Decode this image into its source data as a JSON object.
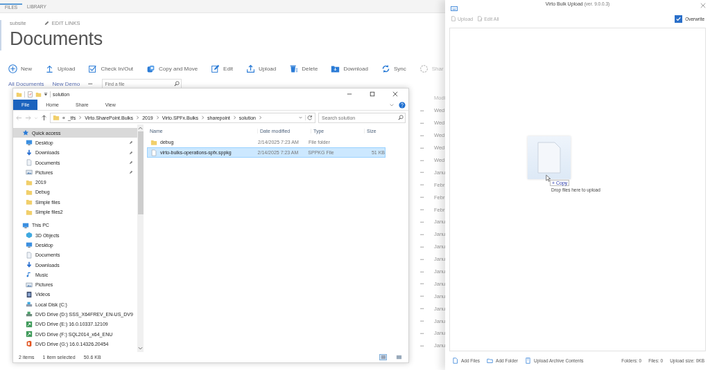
{
  "sharepoint": {
    "ribbon_tabs": [
      "FILES",
      "LIBRARY"
    ],
    "subsite": "subsite",
    "edit_links": "EDIT LINKS",
    "title": "Documents",
    "toolbar": [
      "New",
      "Upload",
      "Check In/Out",
      "Copy and Move",
      "Edit",
      "Upload",
      "Delete",
      "Download",
      "Sync",
      "Shar"
    ],
    "views": [
      "All Documents",
      "New Demo"
    ],
    "views_more": "•••",
    "search": {
      "placeholder": "Find a file"
    },
    "list_header": "Modi",
    "rows": [
      {
        "menu": "•••",
        "modified": "Wed"
      },
      {
        "menu": "•••",
        "modified": "Wed"
      },
      {
        "menu": "•••",
        "modified": "Wed"
      },
      {
        "menu": "•••",
        "modified": "Wed"
      },
      {
        "menu": "•••",
        "modified": "Wed"
      },
      {
        "menu": "•••",
        "modified": "Janu"
      },
      {
        "menu": "•••",
        "modified": "Febr"
      },
      {
        "menu": "•••",
        "modified": "Febr"
      },
      {
        "menu": "•••",
        "modified": "Febr"
      },
      {
        "menu": "•••",
        "modified": "Janu"
      },
      {
        "menu": "•••",
        "modified": "Janu"
      },
      {
        "menu": "•••",
        "modified": "Janu"
      },
      {
        "menu": "•••",
        "modified": "Janu"
      },
      {
        "menu": "•••",
        "modified": "Janu"
      },
      {
        "menu": "•••",
        "modified": "Janu"
      },
      {
        "menu": "•••",
        "modified": "Janu"
      },
      {
        "menu": "•••",
        "modified": "Janu"
      },
      {
        "menu": "•••",
        "modified": "Janu"
      },
      {
        "menu": "•••",
        "modified": "Janu"
      },
      {
        "menu": "•••",
        "modified": "Janu"
      }
    ]
  },
  "explorer": {
    "title": "solution",
    "ribbon_tabs": [
      {
        "label": "File",
        "selected": true
      },
      {
        "label": "Home",
        "selected": false
      },
      {
        "label": "Share",
        "selected": false
      },
      {
        "label": "View",
        "selected": false
      }
    ],
    "path_prefix": "«",
    "path": [
      "_tfs",
      "Virto.SharePoint.Bulks",
      "2019",
      "Virto.SPFx.Bulks",
      "sharepoint",
      "solution"
    ],
    "search": {
      "placeholder": "Search solution"
    },
    "nav": [
      {
        "label": "Quick access",
        "kind": "star",
        "selected": true,
        "children": [
          {
            "label": "Desktop",
            "kind": "desktop",
            "pinned": true
          },
          {
            "label": "Downloads",
            "kind": "download",
            "pinned": true
          },
          {
            "label": "Documents",
            "kind": "documents",
            "pinned": true
          },
          {
            "label": "Pictures",
            "kind": "pictures",
            "pinned": true
          },
          {
            "label": "2019",
            "kind": "folder",
            "pinned": false
          },
          {
            "label": "Debug",
            "kind": "folder",
            "pinned": false
          },
          {
            "label": "Simple files",
            "kind": "folder",
            "pinned": false
          },
          {
            "label": "Simple files2",
            "kind": "folder",
            "pinned": false
          }
        ]
      },
      {
        "label": "This PC",
        "kind": "pc",
        "selected": false,
        "children": [
          {
            "label": "3D Objects",
            "kind": "objects"
          },
          {
            "label": "Desktop",
            "kind": "desktop"
          },
          {
            "label": "Documents",
            "kind": "documents"
          },
          {
            "label": "Downloads",
            "kind": "download"
          },
          {
            "label": "Music",
            "kind": "music"
          },
          {
            "label": "Pictures",
            "kind": "pictures"
          },
          {
            "label": "Videos",
            "kind": "videos"
          },
          {
            "label": "Local Disk (C:)",
            "kind": "disk"
          },
          {
            "label": "DVD Drive (D:) SSS_X64FREV_EN-US_DV9",
            "kind": "dvd"
          },
          {
            "label": "DVD Drive (E:) 16.0.10337.12109",
            "kind": "setup"
          },
          {
            "label": "DVD Drive (F:) SQL2014_x64_ENU",
            "kind": "setup"
          },
          {
            "label": "DVD Drive (G:) 16.0.14326.20454",
            "kind": "office"
          }
        ]
      }
    ],
    "columns": [
      "Name",
      "Date modified",
      "Type",
      "Size"
    ],
    "files": [
      {
        "name": "debug",
        "kind": "folder",
        "date": "2/14/2025 7:23 AM",
        "type": "File folder",
        "selected": false
      },
      {
        "name": "virto-bulks-operations-spfx.sppkg",
        "kind": "file",
        "date": "2/14/2025 7:23 AM",
        "type": "SPPKG File",
        "size": "51 KB",
        "selected": true
      }
    ],
    "status": [
      "2 items",
      "1 item selected",
      "50.6 KB"
    ]
  },
  "upload_panel": {
    "title": "Virto Bulk Upload",
    "version": "(ver. 9.0.0.3)",
    "actions": [
      {
        "label": "Upload",
        "disabled": true
      },
      {
        "label": "Edit All",
        "disabled": true
      }
    ],
    "overwrite": {
      "label": "Overwrite",
      "checked": true
    },
    "drag_badge": "+ Copy",
    "hint": "Drop files here to upload",
    "footer_actions": [
      "Add Files",
      "Add Folder",
      "Upload Archive Contents"
    ],
    "stats": [
      "Folders: 0",
      "Files: 0",
      "Upload size: 0KB"
    ]
  }
}
